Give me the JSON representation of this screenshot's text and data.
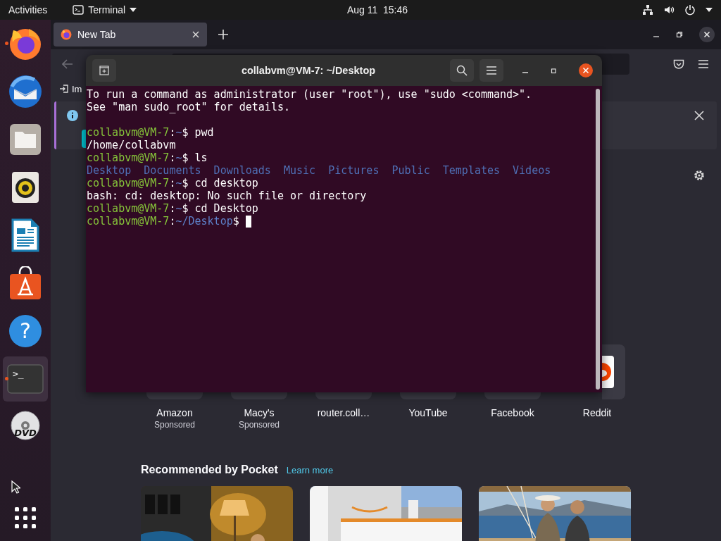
{
  "top_bar": {
    "activities": "Activities",
    "app_menu": "Terminal",
    "clock": "Aug 11  15:46"
  },
  "dock": {
    "items": [
      {
        "kind": "firefox",
        "running": true,
        "selected": false
      },
      {
        "kind": "mail",
        "running": false,
        "selected": false
      },
      {
        "kind": "files",
        "running": false,
        "selected": false
      },
      {
        "kind": "music",
        "running": false,
        "selected": false
      },
      {
        "kind": "writer",
        "running": false,
        "selected": false
      },
      {
        "kind": "store",
        "running": false,
        "selected": false
      },
      {
        "kind": "help",
        "glyph": "?",
        "running": false,
        "selected": false
      },
      {
        "kind": "terminal",
        "glyph": ">_",
        "running": true,
        "selected": true
      },
      {
        "kind": "dvd",
        "glyph": "DVD",
        "running": false,
        "selected": false
      }
    ]
  },
  "browser": {
    "tabs": [
      {
        "label": "New Tab",
        "selected": true
      }
    ],
    "bookmarks": [
      {
        "label": "Im"
      }
    ],
    "top_sites": [
      {
        "label": "Amazon",
        "sublabel": "Sponsored"
      },
      {
        "label": "Macy's",
        "sublabel": "Sponsored"
      },
      {
        "label": "router.coll…"
      },
      {
        "label": "YouTube"
      },
      {
        "label": "Facebook"
      },
      {
        "label": "Reddit"
      }
    ],
    "pocket": {
      "heading": "Recommended by Pocket",
      "link": "Learn more"
    }
  },
  "terminal": {
    "title": "collabvm@VM-7: ~/Desktop",
    "cursor": true,
    "lines": [
      {
        "segments": [
          {
            "kind": "plain",
            "text": "To run a command as administrator (user \"root\"), use \"sudo <command>\"."
          }
        ]
      },
      {
        "segments": [
          {
            "kind": "plain",
            "text": "See \"man sudo_root\" for details."
          }
        ]
      },
      {
        "kind": "blank"
      },
      {
        "segments": [
          {
            "kind": "user",
            "text": "collabvm@VM-7"
          },
          {
            "kind": "plain",
            "text": ":"
          },
          {
            "kind": "path",
            "text": "~"
          },
          {
            "kind": "plain",
            "text": "$ pwd"
          }
        ]
      },
      {
        "segments": [
          {
            "kind": "plain",
            "text": "/home/collabvm"
          }
        ]
      },
      {
        "segments": [
          {
            "kind": "user",
            "text": "collabvm@VM-7"
          },
          {
            "kind": "plain",
            "text": ":"
          },
          {
            "kind": "path",
            "text": "~"
          },
          {
            "kind": "plain",
            "text": "$ ls"
          }
        ]
      },
      {
        "segments": [
          {
            "kind": "dir",
            "text": "Desktop  Documents  Downloads  Music  Pictures  Public  Templates  Videos"
          }
        ]
      },
      {
        "segments": [
          {
            "kind": "user",
            "text": "collabvm@VM-7"
          },
          {
            "kind": "plain",
            "text": ":"
          },
          {
            "kind": "path",
            "text": "~"
          },
          {
            "kind": "plain",
            "text": "$ cd desktop"
          }
        ]
      },
      {
        "segments": [
          {
            "kind": "plain",
            "text": "bash: cd: desktop: No such file or directory"
          }
        ]
      },
      {
        "segments": [
          {
            "kind": "user",
            "text": "collabvm@VM-7"
          },
          {
            "kind": "plain",
            "text": ":"
          },
          {
            "kind": "path",
            "text": "~"
          },
          {
            "kind": "plain",
            "text": "$ cd Desktop"
          }
        ]
      },
      {
        "segments": [
          {
            "kind": "user",
            "text": "collabvm@VM-7"
          },
          {
            "kind": "plain",
            "text": ":"
          },
          {
            "kind": "path",
            "text": "~/Desktop"
          },
          {
            "kind": "plain",
            "text": "$ "
          }
        ]
      }
    ]
  }
}
